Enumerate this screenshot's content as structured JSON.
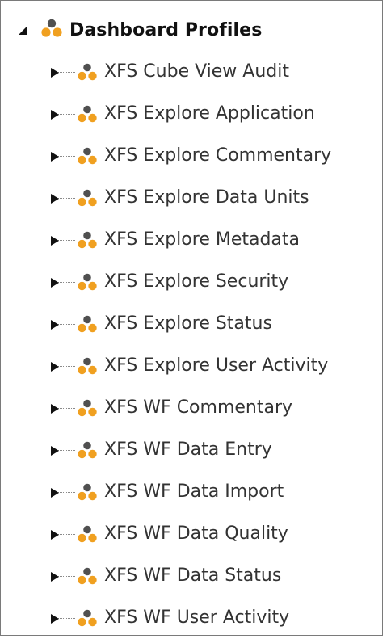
{
  "tree": {
    "root": {
      "label": "Dashboard Profiles",
      "expanded": true,
      "icon": "profile-group-icon"
    },
    "items": [
      {
        "label": "XFS Cube View Audit",
        "icon": "profile-group-icon"
      },
      {
        "label": "XFS Explore Application",
        "icon": "profile-group-icon"
      },
      {
        "label": "XFS Explore Commentary",
        "icon": "profile-group-icon"
      },
      {
        "label": "XFS Explore Data Units",
        "icon": "profile-group-icon"
      },
      {
        "label": "XFS Explore Metadata",
        "icon": "profile-group-icon"
      },
      {
        "label": "XFS Explore Security",
        "icon": "profile-group-icon"
      },
      {
        "label": "XFS Explore Status",
        "icon": "profile-group-icon"
      },
      {
        "label": "XFS Explore User Activity",
        "icon": "profile-group-icon"
      },
      {
        "label": "XFS WF Commentary",
        "icon": "profile-group-icon"
      },
      {
        "label": "XFS WF Data Entry",
        "icon": "profile-group-icon"
      },
      {
        "label": "XFS WF Data Import",
        "icon": "profile-group-icon"
      },
      {
        "label": "XFS WF Data Quality",
        "icon": "profile-group-icon"
      },
      {
        "label": "XFS WF Data Status",
        "icon": "profile-group-icon"
      },
      {
        "label": "XFS WF User Activity",
        "icon": "profile-group-icon"
      }
    ]
  },
  "colors": {
    "icon_dark": "#505050",
    "icon_orange": "#f0a020",
    "guide_line": "#8a8a8a",
    "frame_border": "#7a7a7a"
  }
}
